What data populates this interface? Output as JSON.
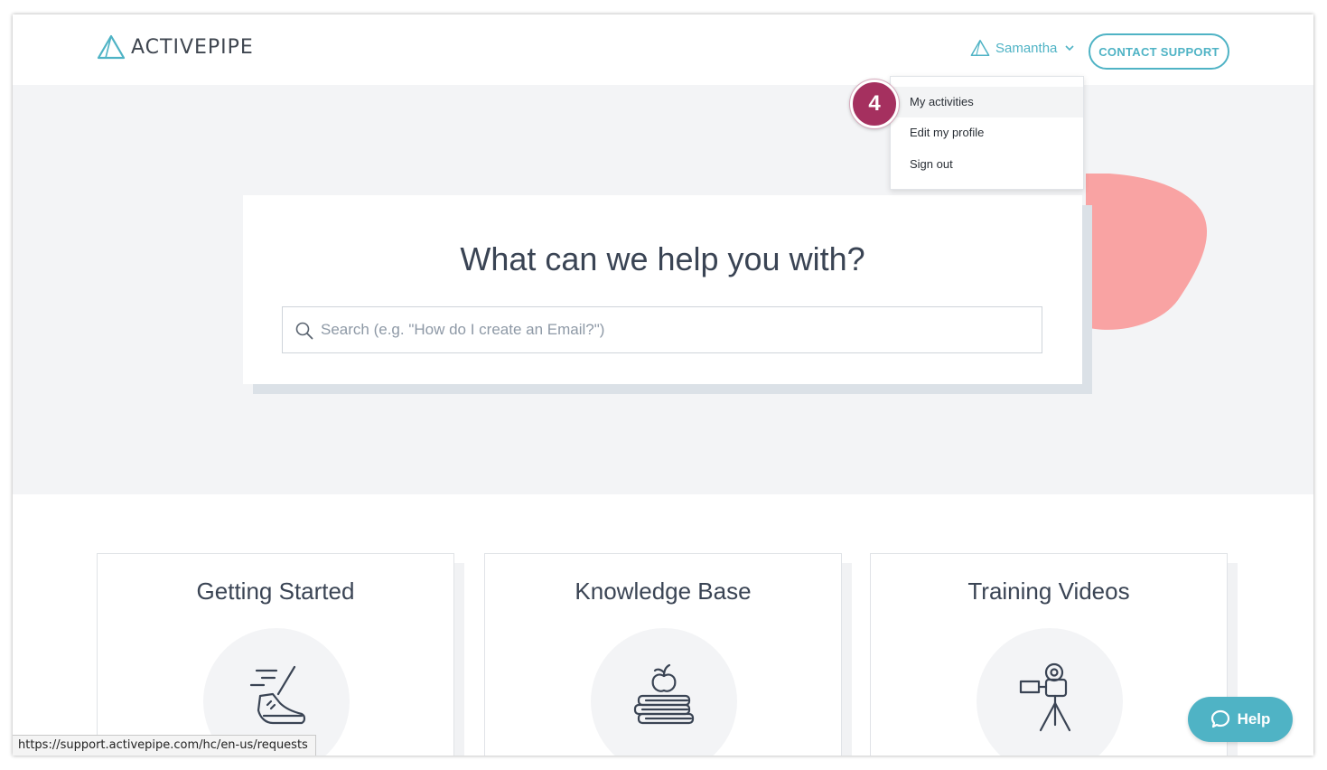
{
  "header": {
    "logo_text": "ACTIVEPIPE",
    "user_name": "Samantha",
    "contact_button": "CONTACT SUPPORT"
  },
  "dropdown": {
    "items": [
      {
        "label": "My activities"
      },
      {
        "label": "Edit my profile"
      },
      {
        "label": "Sign out"
      }
    ]
  },
  "step_badge": "4",
  "hero": {
    "title": "What can we help you with?",
    "search_placeholder": "Search (e.g. \"How do I create an Email?\")"
  },
  "categories": [
    {
      "title": "Getting Started",
      "icon": "running-shoe-icon"
    },
    {
      "title": "Knowledge Base",
      "icon": "books-apple-icon"
    },
    {
      "title": "Training Videos",
      "icon": "video-camera-icon"
    }
  ],
  "status_bar": {
    "url": "https://support.activepipe.com/hc/en-us/requests"
  },
  "help_button": "Help",
  "colors": {
    "accent": "#4fb3c5",
    "badge": "#a5305f",
    "blob": "#f9a3a3",
    "hero_bg": "#f3f4f6"
  }
}
